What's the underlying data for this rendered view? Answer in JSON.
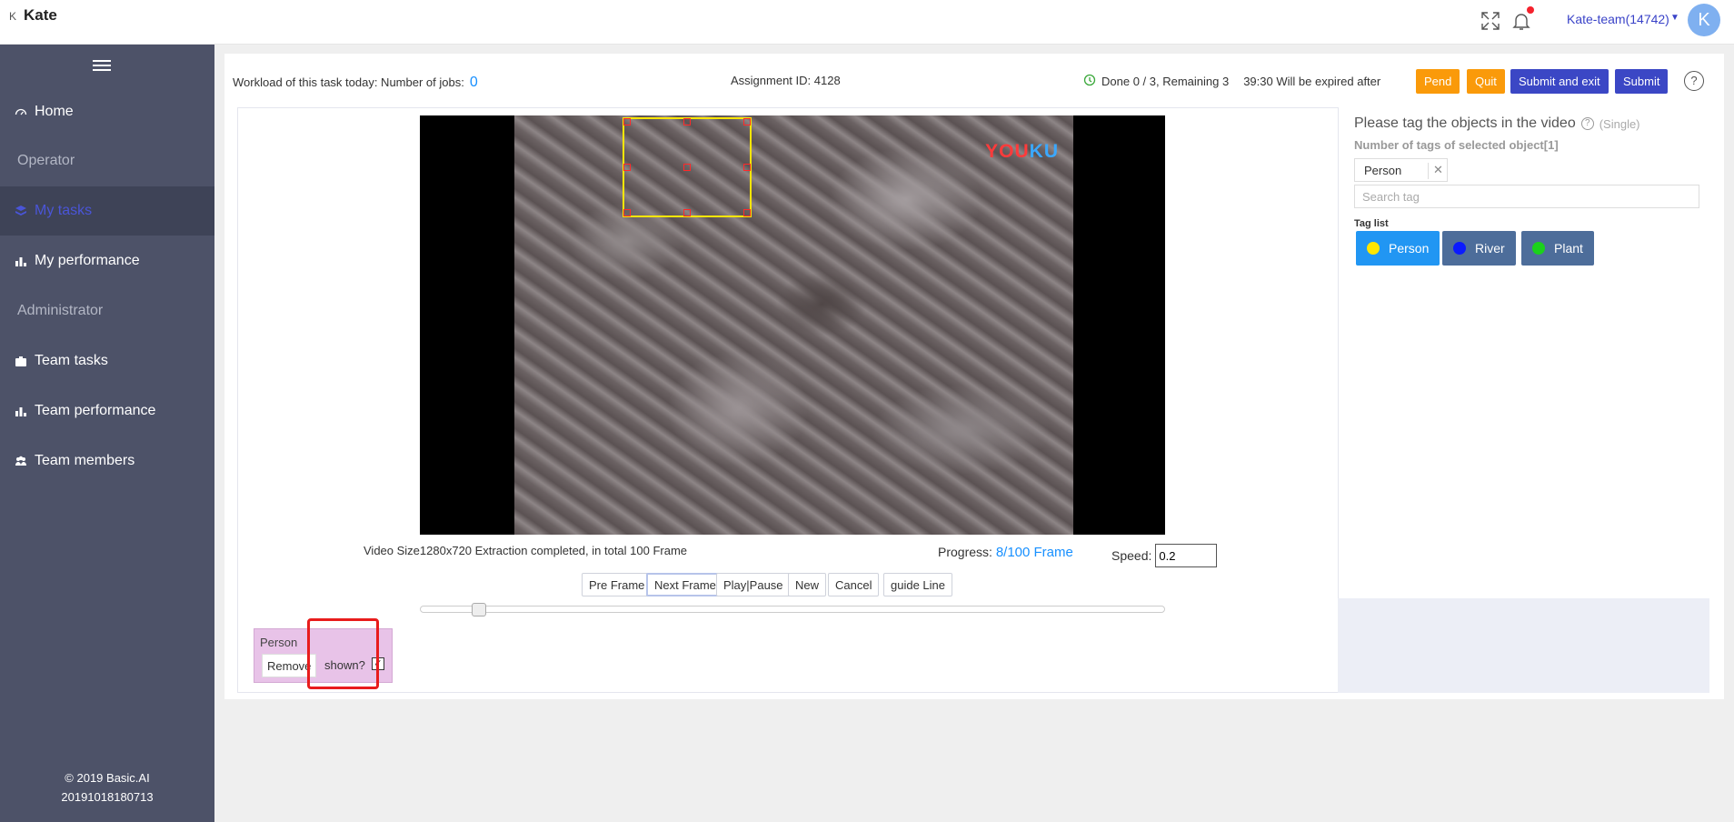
{
  "header": {
    "brand_glyph": "K",
    "app_title": "Kate",
    "team_name": "Kate-team(14742)",
    "avatar_letter": "K",
    "icons": [
      "fullscreen-icon",
      "bell-icon"
    ]
  },
  "sidebar": {
    "items": [
      {
        "label": "Home",
        "icon": "dashboard-icon"
      },
      {
        "label": "Operator",
        "section": true
      },
      {
        "label": "My tasks",
        "icon": "layers-icon",
        "active": true
      },
      {
        "label": "My performance",
        "icon": "bar-chart-icon"
      },
      {
        "label": "Administrator",
        "section": true
      },
      {
        "label": "Team tasks",
        "icon": "briefcase-icon"
      },
      {
        "label": "Team performance",
        "icon": "bar-chart-icon"
      },
      {
        "label": "Team members",
        "icon": "users-icon"
      }
    ],
    "footer_copyright": "© 2019 Basic.AI",
    "footer_build": "20191018180713"
  },
  "task": {
    "workload_label": "Workload of this task today: Number of jobs:",
    "workload_count": "0",
    "assignment": "Assignment ID: 4128",
    "done": "Done 0 / 3, Remaining 3",
    "timer": "39:30 Will be expired after",
    "buttons": {
      "pend": "Pend",
      "quit": "Quit",
      "submit_exit": "Submit and exit",
      "submit": "Submit"
    },
    "help": "?"
  },
  "video": {
    "watermark_a": "YOU",
    "watermark_b": "KU",
    "info": "Video Size1280x720 Extraction completed, in total 100 Frame",
    "progress_label": "Progress:",
    "progress_value": "8/100 Frame",
    "progress_fraction": 0.08,
    "speed_label": "Speed:",
    "speed_value": "0.2",
    "controls": {
      "pre": "Pre Frame",
      "next": "Next Frame",
      "play": "Play|Pause",
      "new": "New",
      "cancel": "Cancel",
      "guide": "guide Line"
    }
  },
  "object": {
    "title": "Person",
    "remove": "Remove",
    "shown_label": "shown?",
    "shown_checked": true
  },
  "tag_panel": {
    "title": "Please tag the objects in the video",
    "help": "?",
    "mode": "(Single)",
    "selected_count": "Number of tags of selected object[1]",
    "selected_tag": "Person",
    "search_placeholder": "Search tag",
    "list_label": "Tag list",
    "tags": [
      {
        "label": "Person",
        "color": "#ffe600",
        "bg": "#2196f3"
      },
      {
        "label": "River",
        "color": "#0a1aff",
        "bg": "#4d6d9a"
      },
      {
        "label": "Plant",
        "color": "#1bd11b",
        "bg": "#4d6d9a"
      }
    ]
  }
}
